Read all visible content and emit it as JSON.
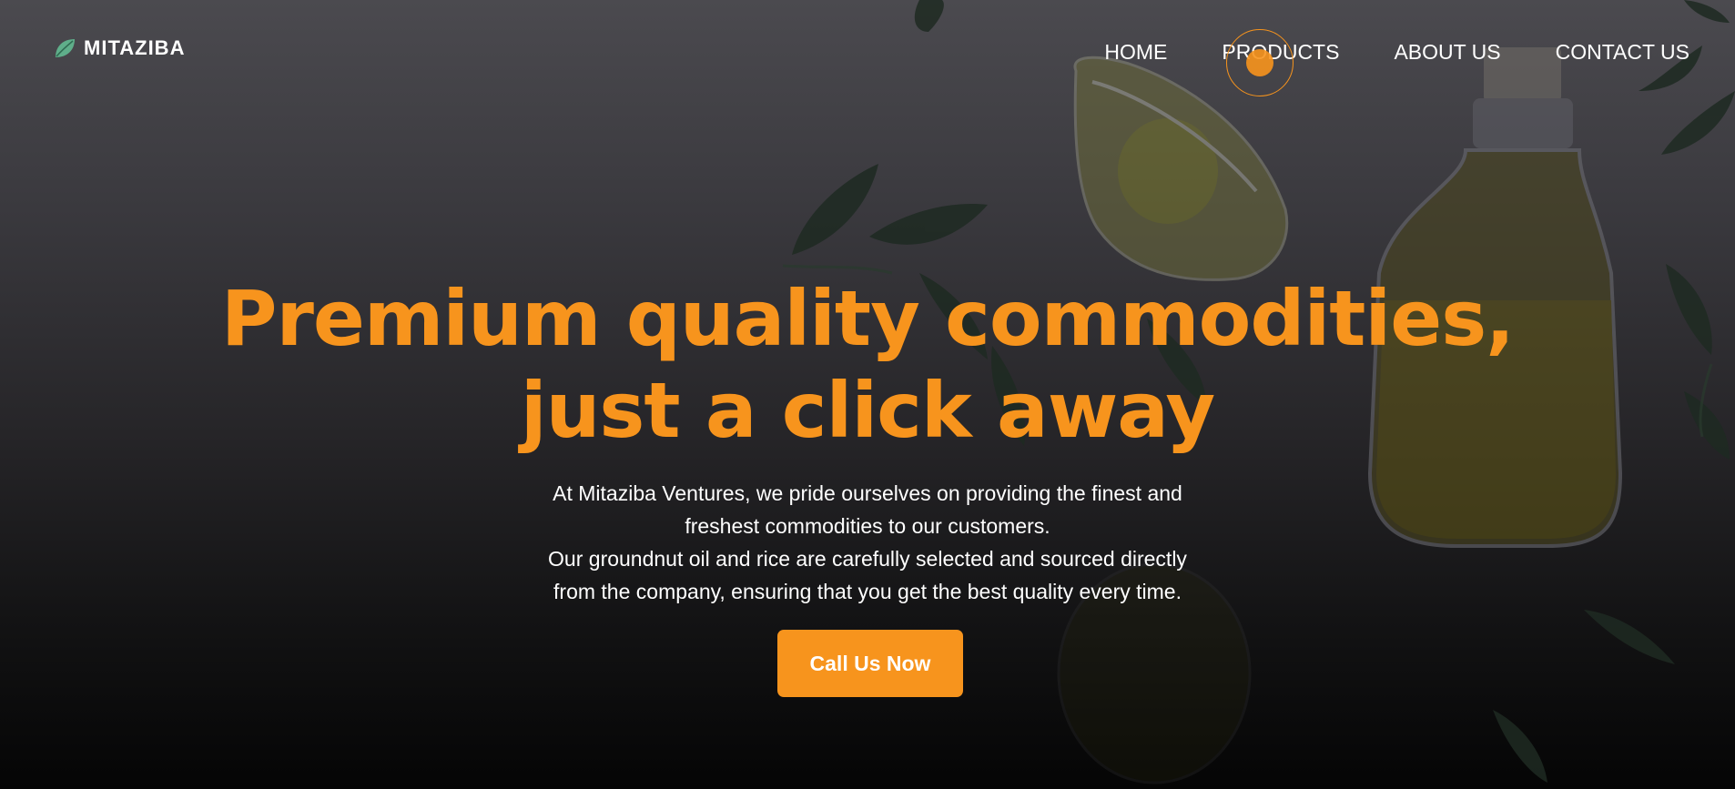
{
  "brand": {
    "name": "MITAZIBA",
    "icon": "leaf-icon"
  },
  "nav": {
    "items": [
      {
        "label": "HOME"
      },
      {
        "label": "PRODUCTS"
      },
      {
        "label": "ABOUT US"
      },
      {
        "label": "CONTACT US"
      }
    ]
  },
  "hero": {
    "headline_line1": "Premium quality commodities,",
    "headline_line2": "just a click away",
    "description_lines": [
      "At Mitaziba Ventures, we pride ourselves on providing the finest and",
      "freshest commodities to our customers.",
      "Our groundnut oil and rice are carefully selected and sourced directly",
      "from the company, ensuring that you get the best quality every time."
    ],
    "cta_label": "Call Us Now"
  },
  "colors": {
    "accent": "#f7941d",
    "text": "#ffffff",
    "logo_leaf": "#5fae8a"
  }
}
